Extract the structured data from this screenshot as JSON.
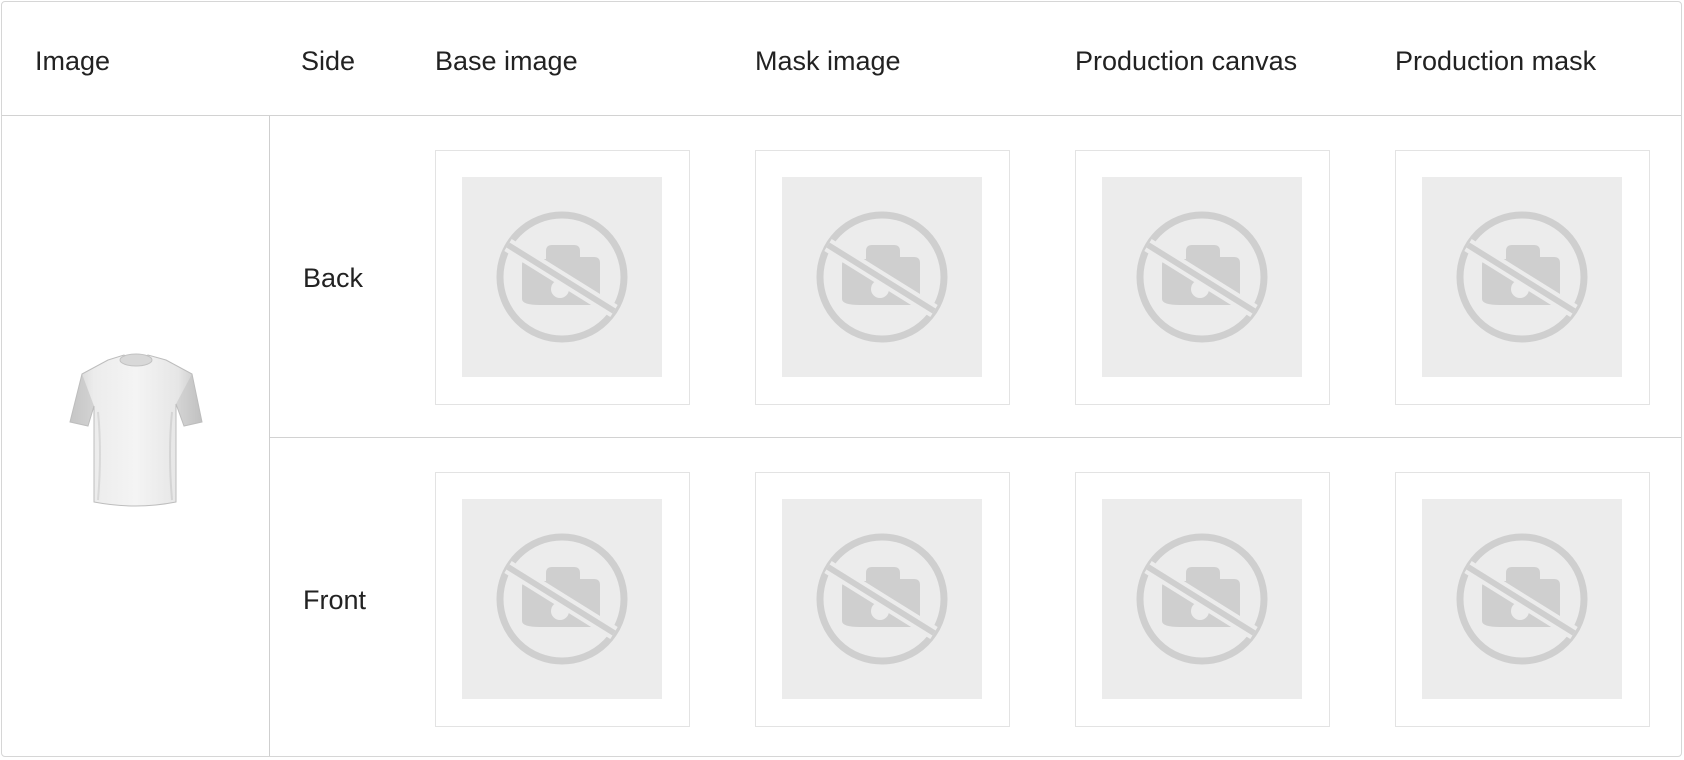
{
  "table": {
    "headers": {
      "image": "Image",
      "side": "Side",
      "base_image": "Base image",
      "mask_image": "Mask image",
      "production_canvas": "Production canvas",
      "production_mask": "Production mask"
    },
    "product_image": "t-shirt-icon",
    "rows": [
      {
        "side": "Back",
        "base_image": "no-image-icon",
        "mask_image": "no-image-icon",
        "production_canvas": "no-image-icon",
        "production_mask": "no-image-icon"
      },
      {
        "side": "Front",
        "base_image": "no-image-icon",
        "mask_image": "no-image-icon",
        "production_canvas": "no-image-icon",
        "production_mask": "no-image-icon"
      }
    ]
  },
  "colors": {
    "border": "#d2d2d2",
    "placeholder_bg": "#ececec",
    "placeholder_icon": "#cfcfcf",
    "text": "#222222"
  }
}
